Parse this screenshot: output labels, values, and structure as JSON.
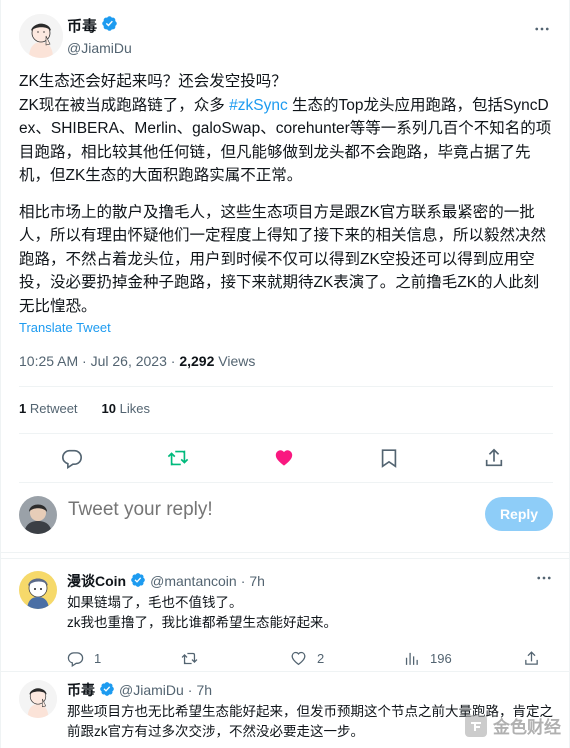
{
  "tweet": {
    "author_name": "币毒",
    "author_handle": "@JiamiDu",
    "paragraphs": [
      {
        "line1": "ZK生态还会好起来吗？还会发空投吗？",
        "pre": "ZK现在被当成跑路链了，众多 ",
        "hashtag": "#zkSync",
        "post": " 生态的Top龙头应用跑路，包括SyncDex、SHIBERA、Merlin、galoSwap、corehunter等等一系列几百个不知名的项目跑路，相比较其他任何链，但凡能够做到龙头都不会跑路，毕竟占据了先机，但ZK生态的大面积跑路实属不正常。"
      },
      {
        "text": "相比市场上的散户及撸毛人，这些生态项目方是跟ZK官方联系最紧密的一批人，所以有理由怀疑他们一定程度上得知了接下来的相关信息，所以毅然决然跑路，不然占着龙头位，用户到时候不仅可以得到ZK空投还可以得到应用空投，没必要扔掉金种子跑路，接下来就期待ZK表演了。之前撸毛ZK的人此刻无比惶恐。"
      }
    ],
    "translate": "Translate Tweet",
    "time": "10:25 AM · Jul 26, 2023 · ",
    "views_count": "2,292",
    "views_label": " Views",
    "retweets_count": "1",
    "retweets_label": " Retweet",
    "likes_count": "10",
    "likes_label": " Likes"
  },
  "reply_box": {
    "placeholder": "Tweet your reply!",
    "button": "Reply"
  },
  "replies": [
    {
      "name": "漫谈Coin",
      "handle": "@mantancoin",
      "sep": " · ",
      "time": "7h",
      "lines": [
        "如果链塌了，毛也不值钱了。",
        "zk我也重撸了，我比谁都希望生态能好起来。"
      ],
      "replies": "1",
      "retweets": "",
      "likes": "2",
      "views": "196"
    },
    {
      "name": "币毒",
      "handle": "@JiamiDu",
      "sep": " · ",
      "time": "7h",
      "lines": [
        "那些项目方也无比希望生态能好起来，但发币预期这个节点之前大量跑路，肯定之前跟zk官方有过多次交涉，不然没必要走这一步。"
      ]
    }
  ],
  "watermark": "金色财经",
  "colors": {
    "accent": "#1d9bf0",
    "like": "#f91880",
    "reply_button": "#8ecdf8",
    "muted": "#536471"
  }
}
